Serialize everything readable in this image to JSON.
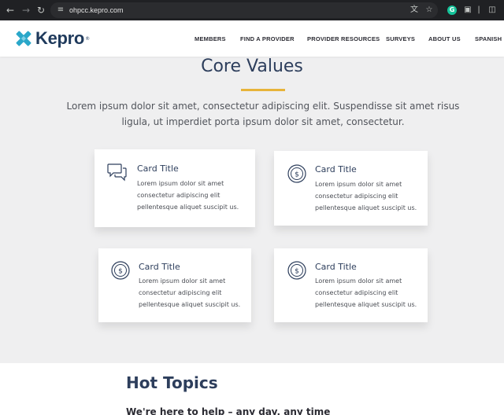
{
  "browser": {
    "url": "ohpcc.kepro.com",
    "back_icon": "arrow-left-icon",
    "forward_icon": "arrow-right-icon",
    "reload_icon": "reload-icon"
  },
  "header": {
    "logo_text": "Kepro",
    "logo_reg": "®",
    "nav": [
      "MEMBERS",
      "FIND A PROVIDER",
      "PROVIDER RESOURCES",
      "SURVEYS",
      "ABOUT US",
      "SPANISH"
    ]
  },
  "core_values": {
    "title": "Core Values",
    "intro": "Lorem ipsum dolor sit amet, consectetur adipiscing elit. Suspendisse sit amet risus ligula, ut imperdiet porta ipsum dolor sit amet, consectetur.",
    "cards": [
      {
        "icon": "chat-bubbles-icon",
        "title": "Card Title",
        "text": "Lorem ipsum dolor sit amet consectetur adipiscing elit pellentesque aliquet suscipit us."
      },
      {
        "icon": "dollar-coin-icon",
        "title": "Card Title",
        "text": "Lorem ipsum dolor sit amet consectetur adipiscing elit pellentesque aliquet suscipit us."
      },
      {
        "icon": "dollar-coin-icon",
        "title": "Card Title",
        "text": "Lorem ipsum dolor sit amet consectetur adipiscing elit pellentesque aliquet suscipit us."
      },
      {
        "icon": "dollar-coin-icon",
        "title": "Card Title",
        "text": "Lorem ipsum dolor sit amet consectetur adipiscing elit pellentesque aliquet suscipit us."
      }
    ]
  },
  "hot_topics": {
    "title": "Hot Topics",
    "subtitle": "We're here to help – any day, any time"
  },
  "colors": {
    "navy": "#2d3e5c",
    "accent": "#e7b43a",
    "logo_teal": "#2aa7c9",
    "page_bg": "#efeff0"
  }
}
